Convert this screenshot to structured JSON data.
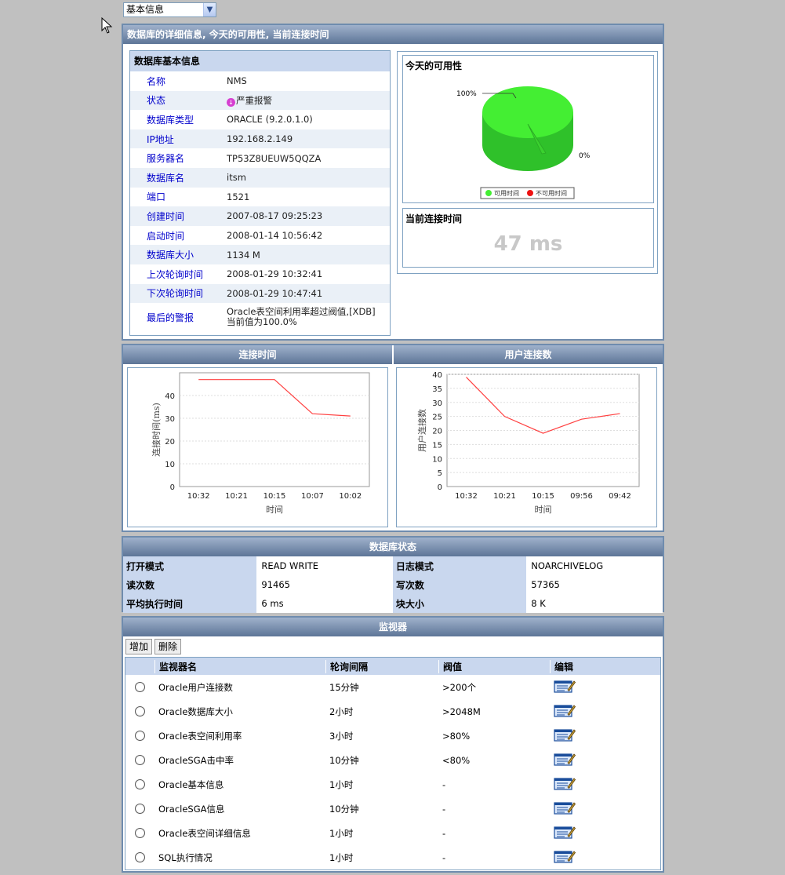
{
  "view_select": {
    "value": "基本信息"
  },
  "detail_panel": {
    "title": "数据库的详细信息, 今天的可用性, 当前连接时间",
    "basic_info_title": "数据库基本信息",
    "rows": [
      {
        "label": "名称",
        "value": "NMS"
      },
      {
        "label": "状态",
        "value": "严重报警"
      },
      {
        "label": "数据库类型",
        "value": "ORACLE (9.2.0.1.0)"
      },
      {
        "label": "IP地址",
        "value": "192.168.2.149"
      },
      {
        "label": "服务器名",
        "value": "TP53Z8UEUW5QQZA"
      },
      {
        "label": "数据库名",
        "value": "itsm"
      },
      {
        "label": "端口",
        "value": "1521"
      },
      {
        "label": "创建时间",
        "value": "2007-08-17 09:25:23"
      },
      {
        "label": "启动时间",
        "value": "2008-01-14 10:56:42"
      },
      {
        "label": "数据库大小",
        "value": "1134 M"
      },
      {
        "label": "上次轮询时间",
        "value": "2008-01-29 10:32:41"
      },
      {
        "label": "下次轮询时间",
        "value": "2008-01-29 10:47:41"
      },
      {
        "label": "最后的警报",
        "value_line1": "Oracle表空间利用率超过阀值,[XDB]",
        "value_line2": "当前值为100.0%"
      }
    ],
    "availability": {
      "title": "今天的可用性",
      "label_available": "100%",
      "label_unavailable": "0%",
      "legend_available": "可用时间",
      "legend_unavailable": "不可用时间",
      "color_available": "#44ee33",
      "color_unavailable": "#ee1111"
    },
    "connection": {
      "title": "当前连接时间",
      "value": "47 ms"
    }
  },
  "charts_panel": {
    "left_title": "连接时间",
    "right_title": "用户连接数"
  },
  "chart_data": [
    {
      "type": "line",
      "categories": [
        "10:32",
        "10:21",
        "10:15",
        "10:07",
        "10:02"
      ],
      "values": [
        47,
        47,
        47,
        32,
        31
      ],
      "xlabel": "时间",
      "ylabel": "连接时间(ms)",
      "ylim": [
        0,
        50
      ],
      "yticks": [
        0,
        10,
        20,
        30,
        40
      ],
      "grid": true,
      "color": "#ff4040"
    },
    {
      "type": "line",
      "categories": [
        "10:32",
        "10:21",
        "10:15",
        "09:56",
        "09:42"
      ],
      "values": [
        39,
        25,
        19,
        24,
        26
      ],
      "xlabel": "时间",
      "ylabel": "用户连接数",
      "ylim": [
        0,
        40
      ],
      "yticks": [
        0,
        5,
        10,
        15,
        20,
        25,
        30,
        35,
        40
      ],
      "grid": true,
      "color": "#ff4040"
    }
  ],
  "status_panel": {
    "title": "数据库状态",
    "rows": [
      {
        "k1": "打开模式",
        "v1": "READ WRITE",
        "k2": "日志模式",
        "v2": "NOARCHIVELOG"
      },
      {
        "k1": "读次数",
        "v1": "91465",
        "k2": "写次数",
        "v2": "57365"
      },
      {
        "k1": "平均执行时间",
        "v1": "6 ms",
        "k2": "块大小",
        "v2": "8 K"
      }
    ]
  },
  "monitor_panel": {
    "title": "监视器",
    "add_label": "增加",
    "delete_label": "删除",
    "headers": {
      "name": "监视器名",
      "interval": "轮询间隔",
      "threshold": "阀值",
      "edit": "编辑"
    },
    "rows": [
      {
        "name": "Oracle用户连接数",
        "interval": "15分钟",
        "threshold": ">200个"
      },
      {
        "name": "Oracle数据库大小",
        "interval": "2小时",
        "threshold": ">2048M"
      },
      {
        "name": "Oracle表空间利用率",
        "interval": "3小时",
        "threshold": ">80%"
      },
      {
        "name": "OracleSGA击中率",
        "interval": "10分钟",
        "threshold": "<80%"
      },
      {
        "name": "Oracle基本信息",
        "interval": "1小时",
        "threshold": "-"
      },
      {
        "name": "OracleSGA信息",
        "interval": "10分钟",
        "threshold": "-"
      },
      {
        "name": "Oracle表空间详细信息",
        "interval": "1小时",
        "threshold": "-"
      },
      {
        "name": "SQL执行情况",
        "interval": "1小时",
        "threshold": "-"
      }
    ]
  }
}
